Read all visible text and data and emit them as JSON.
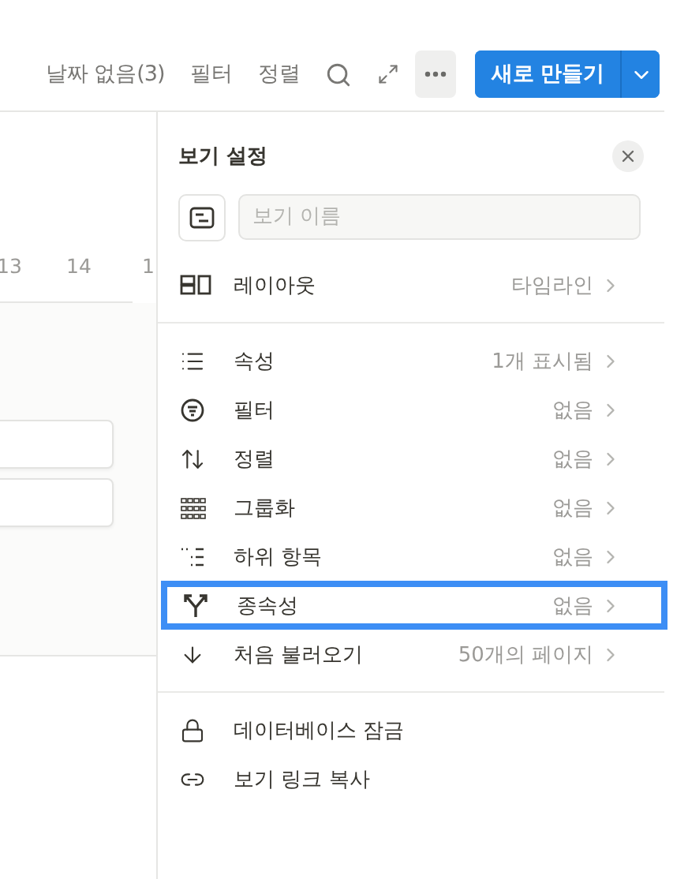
{
  "toolbar": {
    "items": [
      {
        "label": "날짜 없음(3)"
      },
      {
        "label": "필터"
      },
      {
        "label": "정렬"
      }
    ],
    "new_button": {
      "label": "새로 만들기"
    }
  },
  "timeline": {
    "dates": [
      "13",
      "14",
      "1"
    ]
  },
  "view_settings": {
    "title": "보기 설정",
    "name_field": {
      "placeholder": "보기 이름"
    },
    "layout": {
      "label": "레이아웃",
      "value": "타임라인"
    },
    "options": [
      {
        "kind": "properties",
        "label": "속성",
        "value": "1개 표시됨",
        "selected": false
      },
      {
        "kind": "filter",
        "label": "필터",
        "value": "없음",
        "selected": false
      },
      {
        "kind": "sort",
        "label": "정렬",
        "value": "없음",
        "selected": false
      },
      {
        "kind": "group",
        "label": "그룹화",
        "value": "없음",
        "selected": false
      },
      {
        "kind": "subitems",
        "label": "하위 항목",
        "value": "없음",
        "selected": false
      },
      {
        "kind": "dependencies",
        "label": "종속성",
        "value": "없음",
        "selected": true
      },
      {
        "kind": "load",
        "label": "처음 불러오기",
        "value": "50개의 페이지",
        "selected": false
      }
    ],
    "actions": [
      {
        "kind": "lock",
        "label": "데이터베이스 잠금"
      },
      {
        "kind": "link",
        "label": "보기 링크 복사"
      }
    ]
  }
}
